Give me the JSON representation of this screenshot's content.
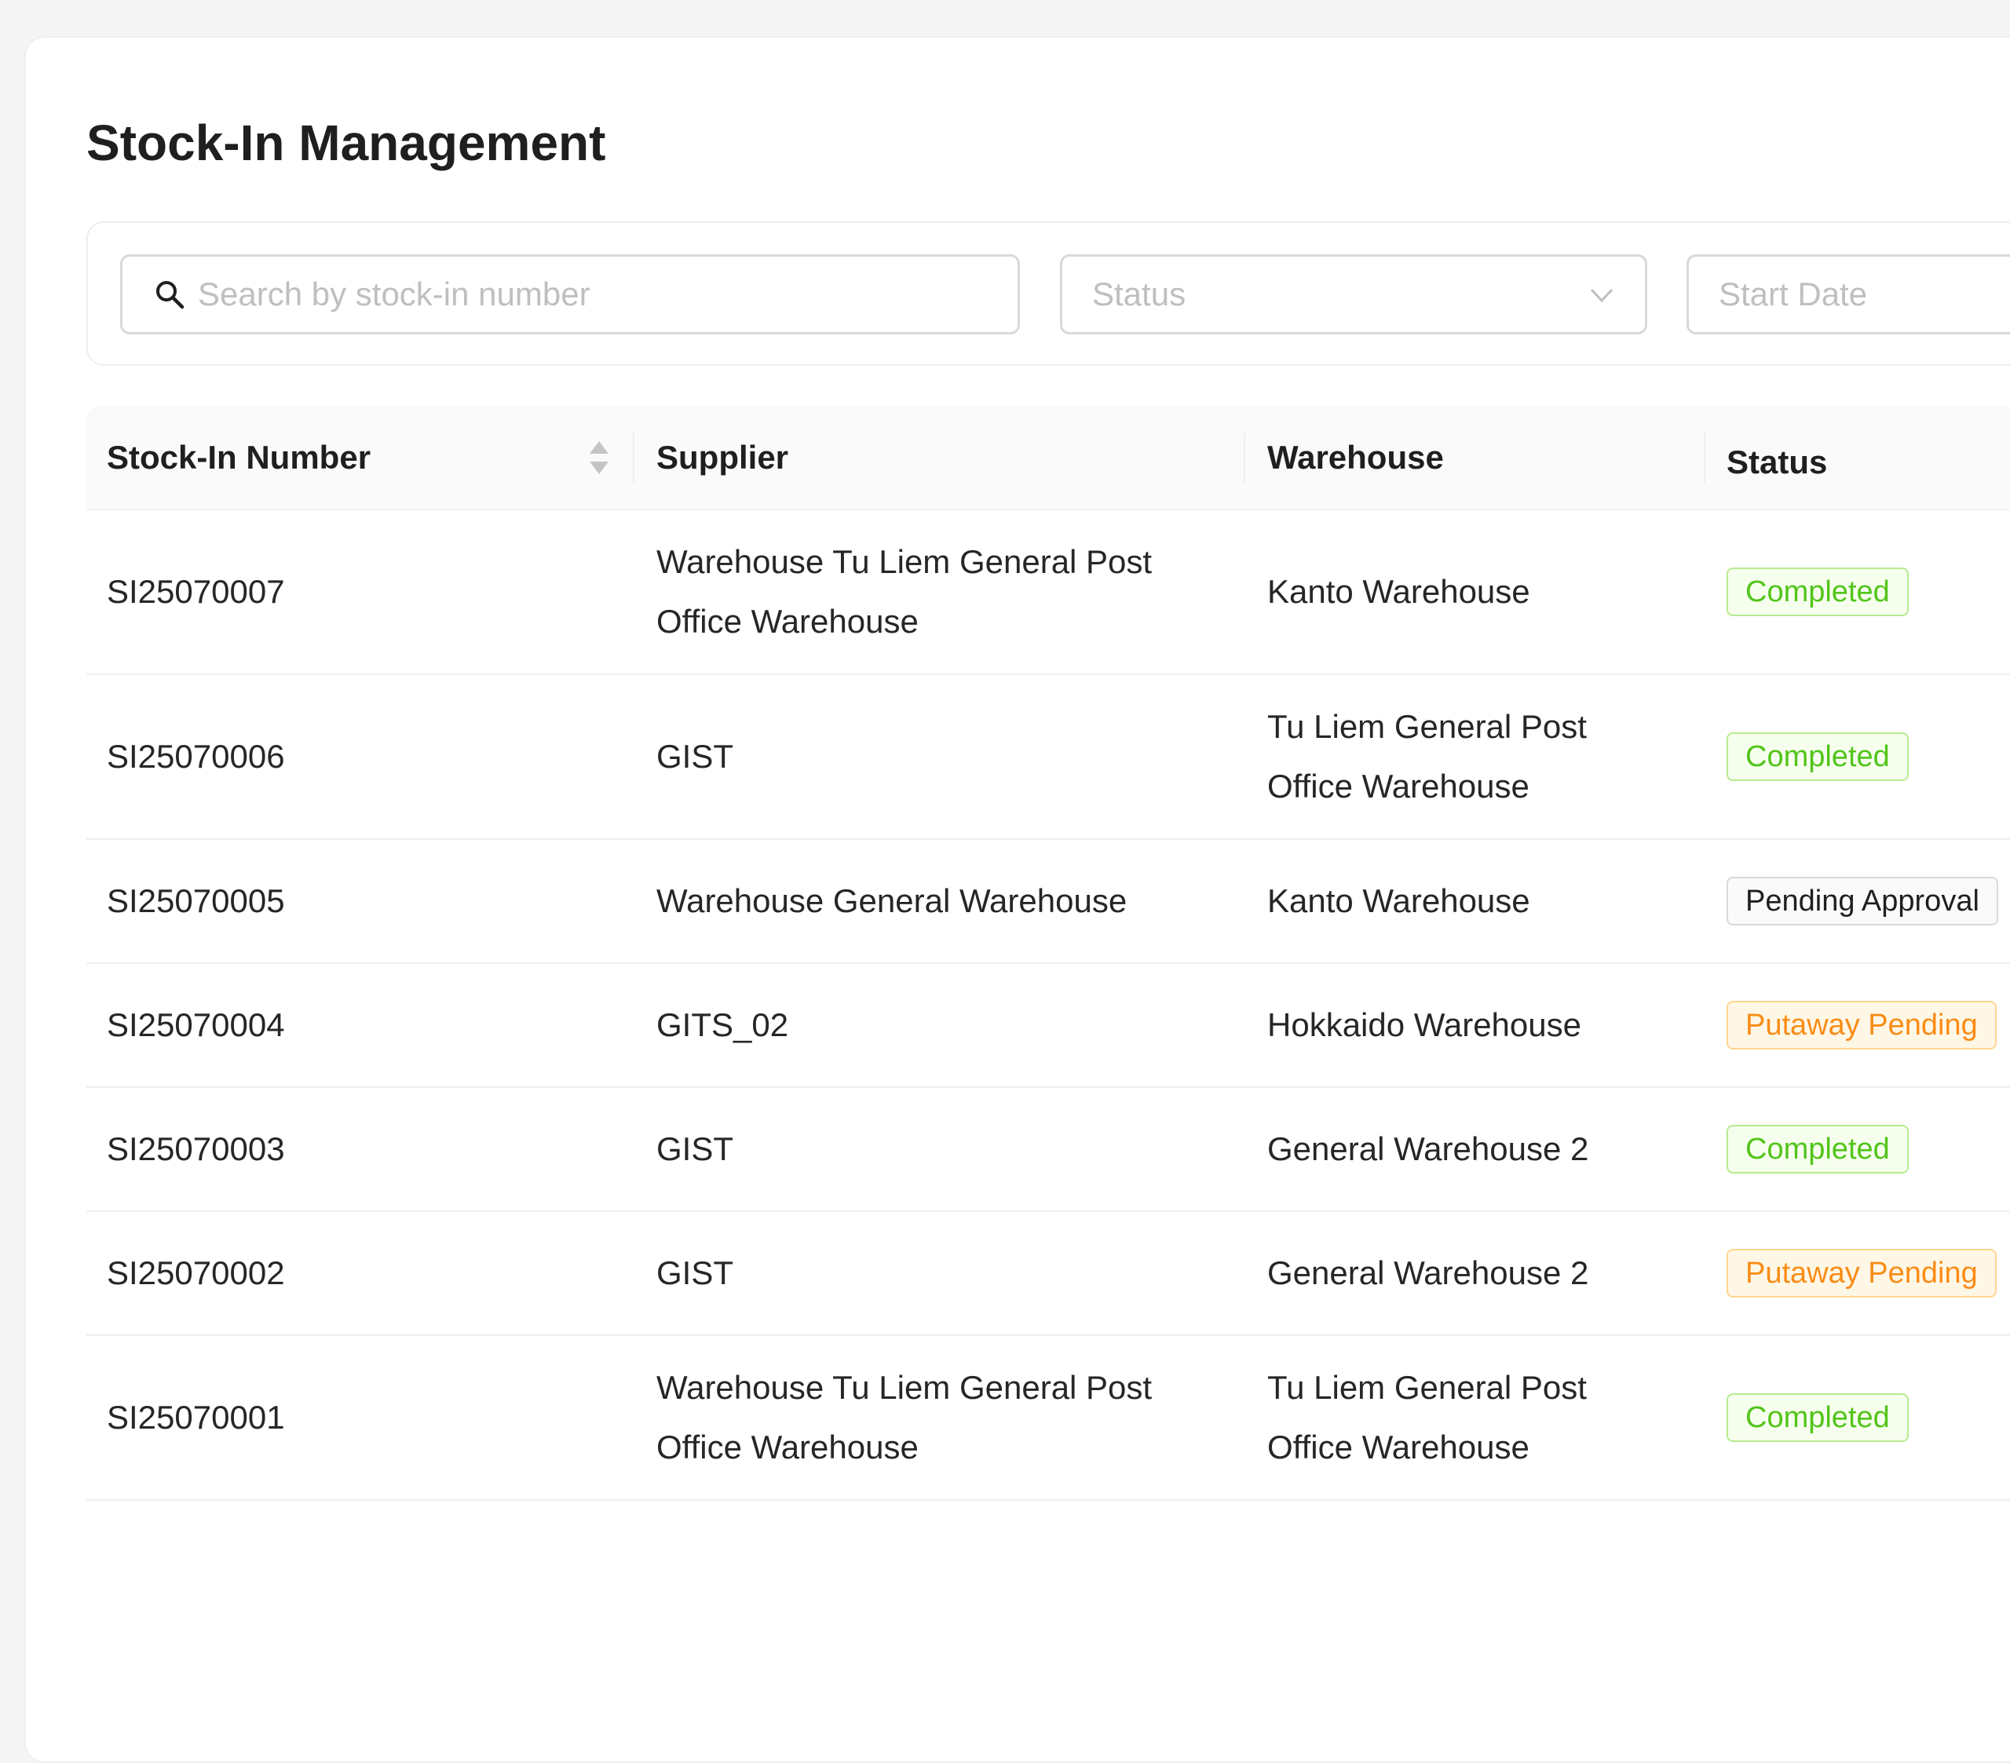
{
  "page": {
    "title": "Stock-In Management"
  },
  "filters": {
    "search_placeholder": "Search by stock-in number",
    "status_placeholder": "Status",
    "start_date_placeholder": "Start Date"
  },
  "table": {
    "columns": [
      {
        "key": "number",
        "label": "Stock-In Number"
      },
      {
        "key": "supplier",
        "label": "Supplier"
      },
      {
        "key": "warehouse",
        "label": "Warehouse"
      },
      {
        "key": "status",
        "label": "Status"
      }
    ],
    "rows": [
      {
        "number": "SI25070007",
        "supplier": "Warehouse Tu Liem General Post Office Warehouse",
        "warehouse": "Kanto Warehouse",
        "status": "Completed",
        "status_type": "success"
      },
      {
        "number": "SI25070006",
        "supplier": "GIST",
        "warehouse": "Tu Liem General Post Office Warehouse",
        "status": "Completed",
        "status_type": "success"
      },
      {
        "number": "SI25070005",
        "supplier": "Warehouse General Warehouse",
        "warehouse": "Kanto Warehouse",
        "status": "Pending Approval",
        "status_type": "default"
      },
      {
        "number": "SI25070004",
        "supplier": "GITS_02",
        "warehouse": "Hokkaido Warehouse",
        "status": "Putaway Pending",
        "status_type": "warning"
      },
      {
        "number": "SI25070003",
        "supplier": "GIST",
        "warehouse": "General Warehouse 2",
        "status": "Completed",
        "status_type": "success"
      },
      {
        "number": "SI25070002",
        "supplier": "GIST",
        "warehouse": "General Warehouse 2",
        "status": "Putaway Pending",
        "status_type": "warning"
      },
      {
        "number": "SI25070001",
        "supplier": "Warehouse Tu Liem General Post Office Warehouse",
        "warehouse": "Tu Liem General Post Office Warehouse",
        "status": "Completed",
        "status_type": "success"
      }
    ]
  },
  "colors": {
    "success": "#52c41a",
    "warning": "#fa8c16",
    "default": "#262626"
  },
  "icons": {
    "search": "search-icon",
    "status_dropdown": "chevron-down-icon",
    "sort": "sort-icon"
  }
}
